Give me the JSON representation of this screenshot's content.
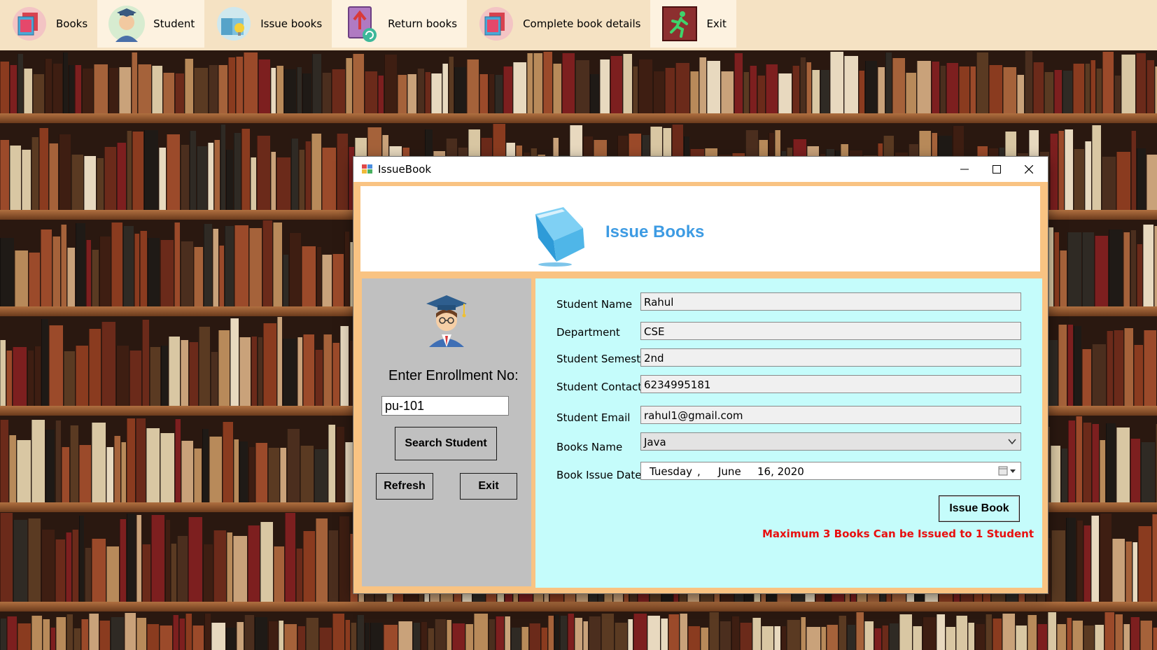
{
  "toolbar": {
    "items": [
      {
        "label": "Books",
        "icon": "books-icon"
      },
      {
        "label": "Student",
        "icon": "student-icon"
      },
      {
        "label": "Issue books",
        "icon": "issue-books-icon"
      },
      {
        "label": "Return books",
        "icon": "return-books-icon"
      },
      {
        "label": "Complete book details",
        "icon": "book-details-icon"
      },
      {
        "label": "Exit",
        "icon": "exit-running-man-icon"
      }
    ]
  },
  "window": {
    "title": "IssueBook",
    "controls": [
      "minimize",
      "maximize",
      "close"
    ]
  },
  "header": {
    "title": "Issue Books"
  },
  "search_panel": {
    "enroll_label": "Enter Enrollment No:",
    "enroll_value": "pu-101",
    "search_button": "Search Student",
    "refresh_button": "Refresh",
    "exit_button": "Exit"
  },
  "student": {
    "fields": [
      {
        "label": "Student Name",
        "value": "Rahul"
      },
      {
        "label": "Department",
        "value": "CSE"
      },
      {
        "label": "Student Semester",
        "value": "2nd"
      },
      {
        "label": "Student Contact",
        "value": "6234995181"
      },
      {
        "label": "Student Email",
        "value": "rahul1@gmail.com"
      }
    ],
    "books_label": "Books Name",
    "books_value": "Java",
    "date_label": "Book Issue Date",
    "date": {
      "weekday": "Tuesday",
      "sep": ",",
      "month": "June",
      "day_year": "16, 2020"
    },
    "issue_button": "Issue Book",
    "limit_note": "Maximum 3 Books Can be Issued to 1 Student"
  },
  "colors": {
    "toolbar_bg": "#f5e2c3",
    "form_border": "#f9c382",
    "right_panel": "#c5fcfb",
    "left_panel": "#c0c0c0",
    "title_blue": "#3d9be3",
    "warning_red": "#e80f0f"
  }
}
